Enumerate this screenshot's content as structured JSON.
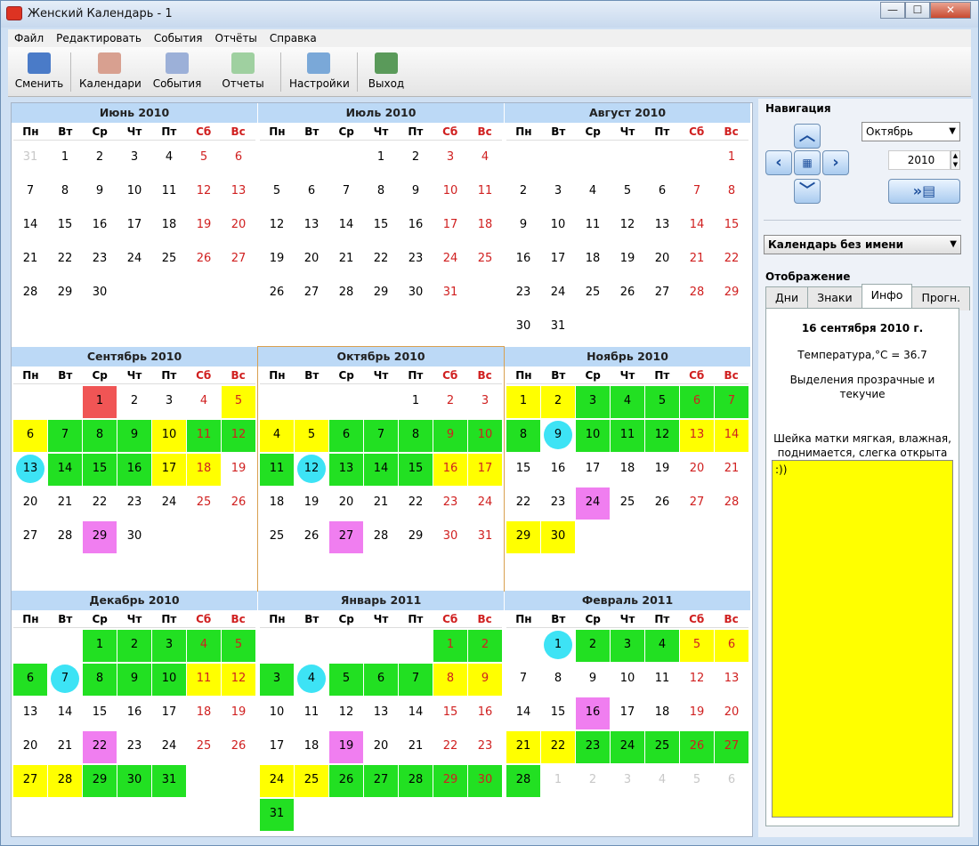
{
  "window": {
    "title": "Женский Календарь - 1",
    "controls": [
      "—",
      "☐",
      "✕"
    ]
  },
  "menu": [
    "Файл",
    "Редактировать",
    "События",
    "Отчёты",
    "Справка"
  ],
  "toolbar": {
    "switch": "Сменить",
    "calendars": "Календари",
    "events": "События",
    "reports": "Отчеты",
    "settings": "Настройки",
    "exit": "Выход"
  },
  "weekdays": [
    "Пн",
    "Вт",
    "Ср",
    "Чт",
    "Пт",
    "Сб",
    "Вс"
  ],
  "months": [
    {
      "title": "Июнь 2010",
      "start": 1,
      "days": 30,
      "lead": [
        31
      ],
      "trail": [],
      "marks": {}
    },
    {
      "title": "Июль 2010",
      "start": 3,
      "days": 31,
      "lead": [],
      "trail": [],
      "marks": {}
    },
    {
      "title": "Август 2010",
      "start": 6,
      "days": 31,
      "lead": [],
      "trail": [],
      "marks": {}
    },
    {
      "title": "Сентябрь 2010",
      "start": 2,
      "days": 30,
      "lead": [],
      "trail": [],
      "marks": {
        "1": "red",
        "5": "yellow",
        "6": "yellow",
        "7": "green",
        "8": "green",
        "9": "green",
        "10": "yellow",
        "11": "green",
        "12": "green",
        "13": "circle",
        "14": "green",
        "15": "green",
        "16": "green",
        "17": "yellow",
        "18": "yellow",
        "29": "pink"
      }
    },
    {
      "title": "Октябрь 2010",
      "start": 4,
      "days": 31,
      "lead": [],
      "trail": [],
      "marks": {
        "4": "yellow",
        "5": "yellow",
        "6": "green",
        "7": "green",
        "8": "green",
        "9": "green",
        "10": "green",
        "11": "green",
        "12": "circle",
        "13": "green",
        "14": "green",
        "15": "green",
        "16": "yellow",
        "17": "yellow",
        "27": "pink"
      }
    },
    {
      "title": "Ноябрь 2010",
      "start": 0,
      "days": 30,
      "lead": [],
      "trail": [],
      "marks": {
        "1": "yellow",
        "2": "yellow",
        "3": "green",
        "4": "green",
        "5": "green",
        "6": "green",
        "7": "green",
        "8": "green",
        "9": "circle",
        "10": "green",
        "11": "green",
        "12": "green",
        "13": "yellow",
        "14": "yellow",
        "24": "pink",
        "29": "yellow",
        "30": "yellow"
      }
    },
    {
      "title": "Декабрь 2010",
      "start": 2,
      "days": 31,
      "lead": [],
      "trail": [],
      "marks": {
        "1": "green",
        "2": "green",
        "3": "green",
        "4": "green",
        "5": "green",
        "6": "green",
        "7": "circle",
        "8": "green",
        "9": "green",
        "10": "green",
        "11": "yellow",
        "12": "yellow",
        "22": "pink",
        "27": "yellow",
        "28": "yellow",
        "29": "green",
        "30": "green",
        "31": "green"
      }
    },
    {
      "title": "Январь 2011",
      "start": 5,
      "days": 31,
      "lead": [],
      "trail": [],
      "marks": {
        "1": "green",
        "2": "green",
        "3": "green",
        "4": "circle",
        "5": "green",
        "6": "green",
        "7": "green",
        "8": "yellow",
        "9": "yellow",
        "19": "pink",
        "24": "yellow",
        "25": "yellow",
        "26": "green",
        "27": "green",
        "28": "green",
        "29": "green",
        "30": "green",
        "31": "green"
      }
    },
    {
      "title": "Февраль 2011",
      "start": 1,
      "days": 28,
      "lead": [],
      "trail": [
        1,
        2,
        3,
        4,
        5,
        6
      ],
      "marks": {
        "1": "circle",
        "2": "green",
        "3": "green",
        "4": "green",
        "5": "yellow",
        "6": "yellow",
        "16": "pink",
        "21": "yellow",
        "22": "yellow",
        "23": "green",
        "24": "green",
        "25": "green",
        "26": "green",
        "27": "green",
        "28": "green"
      }
    }
  ],
  "nav": {
    "title": "Навигация",
    "month": "Октябрь",
    "year": "2010",
    "calendar": "Календарь без имени"
  },
  "display": {
    "title": "Отображение",
    "tabs": [
      "Дни",
      "Знаки",
      "Инфо",
      "Прогн."
    ],
    "date": "16 сентября 2010 г.",
    "temp": "Температура,°С = 36.7",
    "discharge": "Выделения прозрачные и текучие",
    "cervix": "Шейка матки мягкая, влажная, поднимается, слегка открыта",
    "note": ":))"
  },
  "colors": {
    "green": "#22e022",
    "yellow": "#ffff00",
    "pink": "#f07ef0",
    "circle": "#3de3f5",
    "weekend": "#d02020",
    "header": "#bcd9f6"
  }
}
